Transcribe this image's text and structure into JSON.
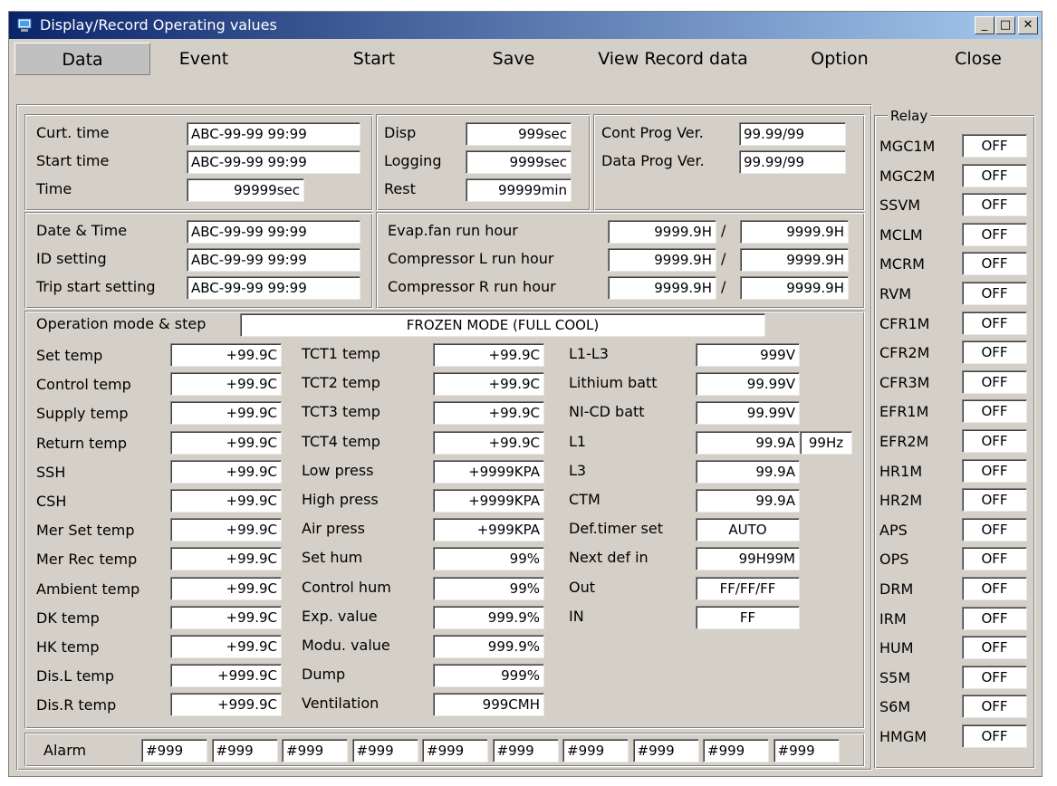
{
  "window": {
    "title": "Display/Record Operating values",
    "min": "_",
    "max": "□",
    "close": "✕"
  },
  "menu": [
    "Data",
    "Event",
    "Start",
    "Save",
    "View Record data",
    "Option",
    "Close"
  ],
  "timeinfo": [
    {
      "label": "Curt. time",
      "value": "ABC-99-99 99:99"
    },
    {
      "label": "Start time",
      "value": "ABC-99-99 99:99"
    },
    {
      "label": "Time",
      "value": "99999sec"
    }
  ],
  "disp": [
    {
      "label": "Disp",
      "value": "999sec"
    },
    {
      "label": "Logging",
      "value": "9999sec"
    },
    {
      "label": "Rest",
      "value": "99999min"
    }
  ],
  "versions": [
    {
      "label": "Cont Prog Ver.",
      "value": "99.99/99"
    },
    {
      "label": "Data Prog Ver.",
      "value": "99.99/99"
    }
  ],
  "settings": [
    {
      "label": "Date & Time",
      "value": "ABC-99-99 99:99"
    },
    {
      "label": "ID setting",
      "value": "ABC-99-99 99:99"
    },
    {
      "label": "Trip start setting",
      "value": "ABC-99-99 99:99"
    }
  ],
  "runhours": [
    {
      "label": "Evap.fan run hour",
      "v1": "9999.9H",
      "v2": "9999.9H"
    },
    {
      "label": "Compressor L run hour",
      "v1": "9999.9H",
      "v2": "9999.9H"
    },
    {
      "label": "Compressor R run hour",
      "v1": "9999.9H",
      "v2": "9999.9H"
    }
  ],
  "slash": "/",
  "opmode": {
    "label": "Operation mode & step",
    "value": "FROZEN MODE (FULL COOL)"
  },
  "col1": [
    {
      "label": "Set temp",
      "value": "+99.9C"
    },
    {
      "label": "Control temp",
      "value": "+99.9C"
    },
    {
      "label": "Supply temp",
      "value": "+99.9C"
    },
    {
      "label": "Return temp",
      "value": "+99.9C"
    },
    {
      "label": "SSH",
      "value": "+99.9C"
    },
    {
      "label": "CSH",
      "value": "+99.9C"
    },
    {
      "label": "Mer Set temp",
      "value": "+99.9C"
    },
    {
      "label": "Mer Rec temp",
      "value": "+99.9C"
    },
    {
      "label": "Ambient temp",
      "value": "+99.9C"
    },
    {
      "label": "DK temp",
      "value": "+99.9C"
    },
    {
      "label": "HK temp",
      "value": "+99.9C"
    },
    {
      "label": "Dis.L temp",
      "value": "+999.9C"
    },
    {
      "label": "Dis.R temp",
      "value": "+999.9C"
    }
  ],
  "col2": [
    {
      "label": "TCT1 temp",
      "value": "+99.9C"
    },
    {
      "label": "TCT2 temp",
      "value": "+99.9C"
    },
    {
      "label": "TCT3 temp",
      "value": "+99.9C"
    },
    {
      "label": "TCT4 temp",
      "value": "+99.9C"
    },
    {
      "label": "Low press",
      "value": "+9999KPA"
    },
    {
      "label": "High press",
      "value": "+9999KPA"
    },
    {
      "label": "Air press",
      "value": "+999KPA"
    },
    {
      "label": "Set hum",
      "value": "99%"
    },
    {
      "label": "Control hum",
      "value": "99%"
    },
    {
      "label": "Exp. value",
      "value": "999.9%"
    },
    {
      "label": "Modu. value",
      "value": "999.9%"
    },
    {
      "label": "Dump",
      "value": "999%"
    },
    {
      "label": "Ventilation",
      "value": "999CMH"
    }
  ],
  "col3": [
    {
      "label": "L1-L3",
      "value": "999V"
    },
    {
      "label": "Lithium batt",
      "value": "99.99V"
    },
    {
      "label": "NI-CD batt",
      "value": "99.99V"
    },
    {
      "label": "L1",
      "value": "99.9A",
      "extra": "99Hz"
    },
    {
      "label": "L3",
      "value": "99.9A"
    },
    {
      "label": "CTM",
      "value": "99.9A"
    },
    {
      "label": "Def.timer set",
      "value": "AUTO"
    },
    {
      "label": "Next def in",
      "value": "99H99M"
    },
    {
      "label": "Out",
      "value": "FF/FF/FF"
    },
    {
      "label": "IN",
      "value": "FF"
    }
  ],
  "alarm": {
    "label": "Alarm",
    "values": [
      "#999",
      "#999",
      "#999",
      "#999",
      "#999",
      "#999",
      "#999",
      "#999",
      "#999",
      "#999"
    ]
  },
  "relay": {
    "title": "Relay",
    "items": [
      {
        "label": "MGC1M",
        "value": "OFF"
      },
      {
        "label": "MGC2M",
        "value": "OFF"
      },
      {
        "label": "SSVM",
        "value": "OFF"
      },
      {
        "label": "MCLM",
        "value": "OFF"
      },
      {
        "label": "MCRM",
        "value": "OFF"
      },
      {
        "label": "RVM",
        "value": "OFF"
      },
      {
        "label": "CFR1M",
        "value": "OFF"
      },
      {
        "label": "CFR2M",
        "value": "OFF"
      },
      {
        "label": "CFR3M",
        "value": "OFF"
      },
      {
        "label": "EFR1M",
        "value": "OFF"
      },
      {
        "label": "EFR2M",
        "value": "OFF"
      },
      {
        "label": "HR1M",
        "value": "OFF"
      },
      {
        "label": "HR2M",
        "value": "OFF"
      },
      {
        "label": "APS",
        "value": "OFF"
      },
      {
        "label": "OPS",
        "value": "OFF"
      },
      {
        "label": "DRM",
        "value": "OFF"
      },
      {
        "label": "IRM",
        "value": "OFF"
      },
      {
        "label": "HUM",
        "value": "OFF"
      },
      {
        "label": "S5M",
        "value": "OFF"
      },
      {
        "label": "S6M",
        "value": "OFF"
      },
      {
        "label": "HMGM",
        "value": "OFF"
      }
    ]
  }
}
